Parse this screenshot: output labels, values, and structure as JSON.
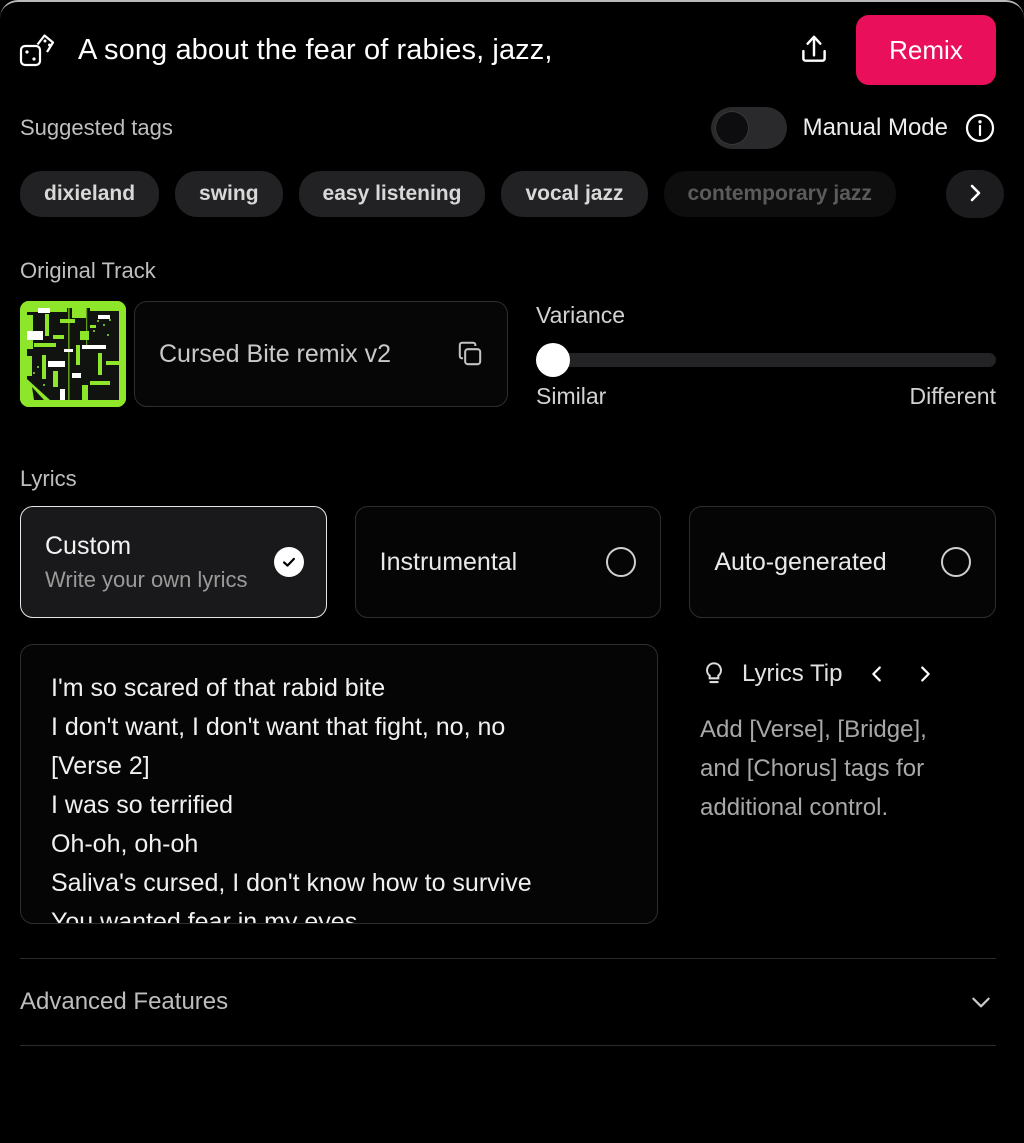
{
  "header": {
    "dice_icon": "dice-icon",
    "title": "A song about the fear of rabies, jazz,",
    "share_icon": "share-upload-icon",
    "remix_label": "Remix"
  },
  "tags": {
    "section_label": "Suggested tags",
    "manual_mode_label": "Manual Mode",
    "manual_mode_on": false,
    "info_icon": "info-icon",
    "next_icon": "chevron-right-icon",
    "items": [
      {
        "label": "dixieland",
        "faded": false
      },
      {
        "label": "swing",
        "faded": false
      },
      {
        "label": "easy listening",
        "faded": false
      },
      {
        "label": "vocal jazz",
        "faded": false
      },
      {
        "label": "contemporary jazz",
        "faded": true
      }
    ]
  },
  "original_track": {
    "section_label": "Original Track",
    "cover_alt": "album-cover-art",
    "track_name": "Cursed Bite remix v2",
    "copy_icon": "copy-icon"
  },
  "variance": {
    "label": "Variance",
    "value_percent": 0,
    "min_label": "Similar",
    "max_label": "Different"
  },
  "lyrics": {
    "section_label": "Lyrics",
    "modes": [
      {
        "title": "Custom",
        "subtitle": "Write your own lyrics",
        "selected": true
      },
      {
        "title": "Instrumental",
        "subtitle": "",
        "selected": false
      },
      {
        "title": "Auto-generated",
        "subtitle": "",
        "selected": false
      }
    ],
    "text": "I'm so scared of that rabid bite\nI don't want, I don't want that fight, no, no\n[Verse 2]\nI was so terrified\nOh-oh, oh-oh\nSaliva's cursed, I don't know how to survive\nYou wanted fear in my eyes",
    "placeholder": "Write your own lyrics"
  },
  "tip": {
    "bulb_icon": "lightbulb-icon",
    "title": "Lyrics Tip",
    "prev_icon": "chevron-left-icon",
    "next_icon": "chevron-right-icon",
    "text": "Add [Verse], [Bridge], and [Chorus] tags for additional control."
  },
  "advanced": {
    "label": "Advanced Features",
    "chevron_icon": "chevron-down-icon"
  },
  "colors": {
    "accent_pink": "#ea0f5a",
    "background": "#000000",
    "cover_green": "#8ee62a",
    "muted_text": "#bfbfbf"
  }
}
